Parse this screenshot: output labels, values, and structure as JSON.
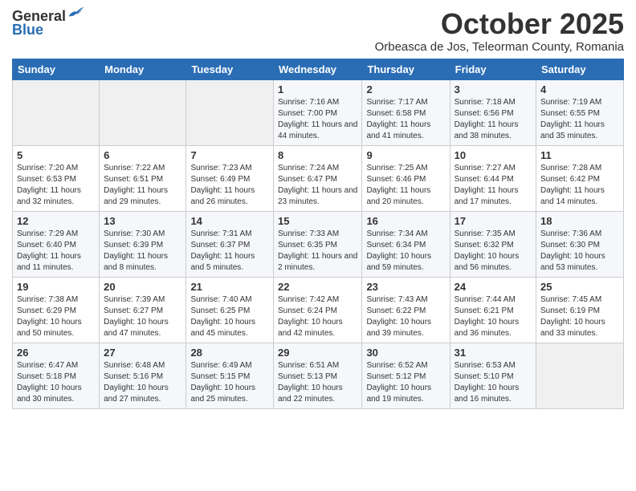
{
  "header": {
    "logo_general": "General",
    "logo_blue": "Blue",
    "month_title": "October 2025",
    "subtitle": "Orbeasca de Jos, Teleorman County, Romania"
  },
  "weekdays": [
    "Sunday",
    "Monday",
    "Tuesday",
    "Wednesday",
    "Thursday",
    "Friday",
    "Saturday"
  ],
  "weeks": [
    [
      {
        "day": "",
        "info": ""
      },
      {
        "day": "",
        "info": ""
      },
      {
        "day": "",
        "info": ""
      },
      {
        "day": "1",
        "info": "Sunrise: 7:16 AM\nSunset: 7:00 PM\nDaylight: 11 hours and 44 minutes."
      },
      {
        "day": "2",
        "info": "Sunrise: 7:17 AM\nSunset: 6:58 PM\nDaylight: 11 hours and 41 minutes."
      },
      {
        "day": "3",
        "info": "Sunrise: 7:18 AM\nSunset: 6:56 PM\nDaylight: 11 hours and 38 minutes."
      },
      {
        "day": "4",
        "info": "Sunrise: 7:19 AM\nSunset: 6:55 PM\nDaylight: 11 hours and 35 minutes."
      }
    ],
    [
      {
        "day": "5",
        "info": "Sunrise: 7:20 AM\nSunset: 6:53 PM\nDaylight: 11 hours and 32 minutes."
      },
      {
        "day": "6",
        "info": "Sunrise: 7:22 AM\nSunset: 6:51 PM\nDaylight: 11 hours and 29 minutes."
      },
      {
        "day": "7",
        "info": "Sunrise: 7:23 AM\nSunset: 6:49 PM\nDaylight: 11 hours and 26 minutes."
      },
      {
        "day": "8",
        "info": "Sunrise: 7:24 AM\nSunset: 6:47 PM\nDaylight: 11 hours and 23 minutes."
      },
      {
        "day": "9",
        "info": "Sunrise: 7:25 AM\nSunset: 6:46 PM\nDaylight: 11 hours and 20 minutes."
      },
      {
        "day": "10",
        "info": "Sunrise: 7:27 AM\nSunset: 6:44 PM\nDaylight: 11 hours and 17 minutes."
      },
      {
        "day": "11",
        "info": "Sunrise: 7:28 AM\nSunset: 6:42 PM\nDaylight: 11 hours and 14 minutes."
      }
    ],
    [
      {
        "day": "12",
        "info": "Sunrise: 7:29 AM\nSunset: 6:40 PM\nDaylight: 11 hours and 11 minutes."
      },
      {
        "day": "13",
        "info": "Sunrise: 7:30 AM\nSunset: 6:39 PM\nDaylight: 11 hours and 8 minutes."
      },
      {
        "day": "14",
        "info": "Sunrise: 7:31 AM\nSunset: 6:37 PM\nDaylight: 11 hours and 5 minutes."
      },
      {
        "day": "15",
        "info": "Sunrise: 7:33 AM\nSunset: 6:35 PM\nDaylight: 11 hours and 2 minutes."
      },
      {
        "day": "16",
        "info": "Sunrise: 7:34 AM\nSunset: 6:34 PM\nDaylight: 10 hours and 59 minutes."
      },
      {
        "day": "17",
        "info": "Sunrise: 7:35 AM\nSunset: 6:32 PM\nDaylight: 10 hours and 56 minutes."
      },
      {
        "day": "18",
        "info": "Sunrise: 7:36 AM\nSunset: 6:30 PM\nDaylight: 10 hours and 53 minutes."
      }
    ],
    [
      {
        "day": "19",
        "info": "Sunrise: 7:38 AM\nSunset: 6:29 PM\nDaylight: 10 hours and 50 minutes."
      },
      {
        "day": "20",
        "info": "Sunrise: 7:39 AM\nSunset: 6:27 PM\nDaylight: 10 hours and 47 minutes."
      },
      {
        "day": "21",
        "info": "Sunrise: 7:40 AM\nSunset: 6:25 PM\nDaylight: 10 hours and 45 minutes."
      },
      {
        "day": "22",
        "info": "Sunrise: 7:42 AM\nSunset: 6:24 PM\nDaylight: 10 hours and 42 minutes."
      },
      {
        "day": "23",
        "info": "Sunrise: 7:43 AM\nSunset: 6:22 PM\nDaylight: 10 hours and 39 minutes."
      },
      {
        "day": "24",
        "info": "Sunrise: 7:44 AM\nSunset: 6:21 PM\nDaylight: 10 hours and 36 minutes."
      },
      {
        "day": "25",
        "info": "Sunrise: 7:45 AM\nSunset: 6:19 PM\nDaylight: 10 hours and 33 minutes."
      }
    ],
    [
      {
        "day": "26",
        "info": "Sunrise: 6:47 AM\nSunset: 5:18 PM\nDaylight: 10 hours and 30 minutes."
      },
      {
        "day": "27",
        "info": "Sunrise: 6:48 AM\nSunset: 5:16 PM\nDaylight: 10 hours and 27 minutes."
      },
      {
        "day": "28",
        "info": "Sunrise: 6:49 AM\nSunset: 5:15 PM\nDaylight: 10 hours and 25 minutes."
      },
      {
        "day": "29",
        "info": "Sunrise: 6:51 AM\nSunset: 5:13 PM\nDaylight: 10 hours and 22 minutes."
      },
      {
        "day": "30",
        "info": "Sunrise: 6:52 AM\nSunset: 5:12 PM\nDaylight: 10 hours and 19 minutes."
      },
      {
        "day": "31",
        "info": "Sunrise: 6:53 AM\nSunset: 5:10 PM\nDaylight: 10 hours and 16 minutes."
      },
      {
        "day": "",
        "info": ""
      }
    ]
  ]
}
